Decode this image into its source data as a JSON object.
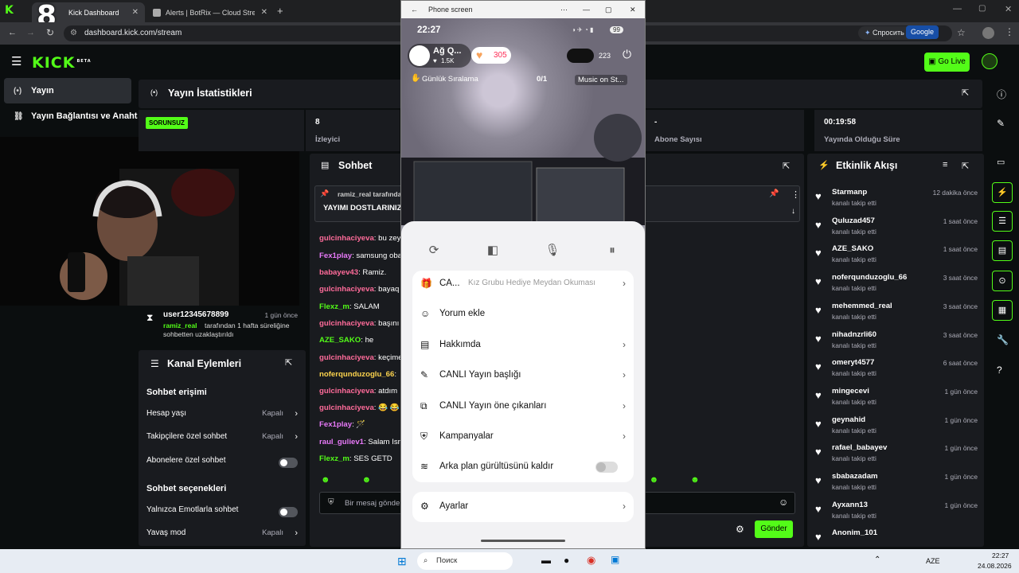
{
  "browser": {
    "tabs": [
      {
        "title": "Kick Dashboard",
        "active": true
      },
      {
        "title": "Alerts | BotRix — Cloud Stream",
        "active": false
      }
    ],
    "url": "dashboard.kick.com/stream",
    "gemini_label": "Спросить Gemini",
    "google_label": "Google"
  },
  "overlay_number": "8",
  "nav": {
    "logo": "KICK",
    "logo_badge": "BETA",
    "go_live": "Go Live",
    "items": [
      {
        "label": "Yayın",
        "active": true
      },
      {
        "label": "Yayın Bağlantısı ve Anahtarı",
        "active": false
      }
    ]
  },
  "stats": {
    "title": "Yayın İstatistikleri",
    "status_badge": "SORUNSUZ",
    "cells": [
      {
        "value": "8",
        "label": "İzleyici"
      },
      {
        "value": "-",
        "label": "Abone Sayısı"
      },
      {
        "value": "00:19:58",
        "label": "Yayında Olduğu Süre"
      }
    ]
  },
  "moderation_event": {
    "user": "user12345678899",
    "time": "1 gün önce",
    "moderator": "ramiz_real",
    "text": "tarafından 1 hafta süreliğine sohbetten uzaklaştırıldı"
  },
  "channel_actions": {
    "title": "Kanal Eylemleri",
    "chat_access_heading": "Sohbet erişimi",
    "rows": [
      {
        "label": "Hesap yaşı",
        "value": "Kapalı",
        "kind": "chevron"
      },
      {
        "label": "Takipçilere özel sohbet",
        "value": "Kapalı",
        "kind": "chevron"
      },
      {
        "label": "Abonelere özel sohbet",
        "value": "",
        "kind": "toggle"
      }
    ],
    "chat_options_heading": "Sohbet seçenekleri",
    "rows2": [
      {
        "label": "Yalnızca Emotlarla sohbet",
        "value": "",
        "kind": "toggle"
      },
      {
        "label": "Yavaş mod",
        "value": "Kapalı",
        "kind": "chevron"
      }
    ]
  },
  "chat": {
    "title": "Sohbet",
    "pinned_by": "ramiz_real tarafından",
    "pinned_text": "YAYIMI DOSTLARINIZL",
    "messages": [
      {
        "user": "gulcinhaciyeva",
        "text": "bu zey",
        "color": "#ff6b9a"
      },
      {
        "user": "Fex1play",
        "text": "samsung oba",
        "color": "#e879f9"
      },
      {
        "user": "babayev43",
        "text": "Ramiz.",
        "color": "#ff6b9a"
      },
      {
        "user": "gulcinhaciyeva",
        "text": "bayaq",
        "color": "#ff6b9a"
      },
      {
        "user": "Flexz_m",
        "text": "SALAM",
        "color": "#53fc18"
      },
      {
        "user": "gulcinhaciyeva",
        "text": "başını",
        "color": "#ff6b9a"
      },
      {
        "user": "AZE_SAKO",
        "text": "he",
        "color": "#53fc18"
      },
      {
        "user": "gulcinhaciyeva",
        "text": "keçime",
        "color": "#ff6b9a"
      },
      {
        "user": "noferqunduzoglu_66",
        "text": "",
        "color": "#fcd34d"
      },
      {
        "user": "gulcinhaciyeva",
        "text": "atdım",
        "color": "#ff6b9a"
      },
      {
        "user": "gulcinhaciyeva",
        "text": "😂 😂",
        "color": "#ff6b9a"
      },
      {
        "user": "Fex1play",
        "text": "🪄",
        "color": "#e879f9"
      },
      {
        "user": "raul_guliev1",
        "text": "Salam Isra",
        "color": "#e879f9"
      },
      {
        "user": "Flexz_m",
        "text": "SES GETD",
        "color": "#53fc18"
      }
    ],
    "input_placeholder": "Bir mesaj gönder",
    "send_label": "Gönder"
  },
  "activity": {
    "title": "Etkinlik Akışı",
    "items": [
      {
        "user": "Starmanp",
        "desc": "kanalı takip etti",
        "time": "12 dakika önce"
      },
      {
        "user": "Quluzad457",
        "desc": "kanalı takip etti",
        "time": "1 saat önce"
      },
      {
        "user": "AZE_SAKO",
        "desc": "kanalı takip etti",
        "time": "1 saat önce"
      },
      {
        "user": "noferqunduzoglu_66",
        "desc": "kanalı takip etti",
        "time": "3 saat önce"
      },
      {
        "user": "mehemmed_real",
        "desc": "kanalı takip etti",
        "time": "3 saat önce"
      },
      {
        "user": "nihadnzrli60",
        "desc": "kanalı takip etti",
        "time": "3 saat önce"
      },
      {
        "user": "omeryt4577",
        "desc": "kanalı takip etti",
        "time": "6 saat önce"
      },
      {
        "user": "mingecevi",
        "desc": "kanalı takip etti",
        "time": "1 gün önce"
      },
      {
        "user": "geynahid",
        "desc": "kanalı takip etti",
        "time": "1 gün önce"
      },
      {
        "user": "rafael_babayev",
        "desc": "kanalı takip etti",
        "time": "1 gün önce"
      },
      {
        "user": "sbabazadam",
        "desc": "kanalı takip etti",
        "time": "1 gün önce"
      },
      {
        "user": "Ayxann13",
        "desc": "kanalı takip etti",
        "time": "1 gün önce"
      },
      {
        "user": "Anonim_101",
        "desc": "",
        "time": ""
      }
    ]
  },
  "phone": {
    "window_title": "Phone screen",
    "status_time": "22:27",
    "battery": "99",
    "streamer_name": "Ağ Q...",
    "likes": "1.5K",
    "gift_count": "305",
    "viewers": "223",
    "ranking_label": "Günlük Sıralama",
    "rank_fraction": "0/1",
    "music_label": "Music on St...",
    "menu": [
      {
        "label": "CA...",
        "extra": "Kız Grubu Hediye Meydan Okuması",
        "icon": "gift-icon"
      },
      {
        "label": "Yorum ekle",
        "extra": "",
        "icon": "comment-icon"
      },
      {
        "label": "Hakkımda",
        "extra": "",
        "icon": "doc-icon"
      },
      {
        "label": "CANLI Yayın başlığı",
        "extra": "",
        "icon": "pen-icon"
      },
      {
        "label": "CANLI Yayın öne çıkanları",
        "extra": "",
        "icon": "highlight-icon"
      },
      {
        "label": "Kampanyalar",
        "extra": "",
        "icon": "shield-icon"
      },
      {
        "label": "Arka plan gürültüsünü kaldır",
        "extra": "",
        "icon": "wave-icon"
      }
    ],
    "settings_label": "Ayarlar"
  },
  "taskbar": {
    "search_placeholder": "Поиск",
    "lang": "AZE",
    "time": "22:27",
    "date": "24.08.2026"
  }
}
